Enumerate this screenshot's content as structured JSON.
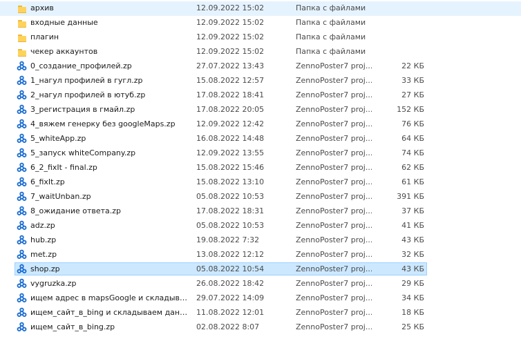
{
  "files": [
    {
      "name": "архив",
      "date": "12.09.2022 15:02",
      "type": "Папка с файлами",
      "size": "",
      "icon": "folder-icon",
      "state": "hover"
    },
    {
      "name": "входные данные",
      "date": "12.09.2022 15:02",
      "type": "Папка с файлами",
      "size": "",
      "icon": "folder-icon",
      "state": ""
    },
    {
      "name": "плагин",
      "date": "12.09.2022 15:02",
      "type": "Папка с файлами",
      "size": "",
      "icon": "folder-icon",
      "state": ""
    },
    {
      "name": "чекер аккаунтов",
      "date": "12.09.2022 15:02",
      "type": "Папка с файлами",
      "size": "",
      "icon": "folder-icon",
      "state": ""
    },
    {
      "name": "0_создание_профилей.zp",
      "date": "27.07.2022 13:43",
      "type": "ZennoPoster7 proj...",
      "size": "22 КБ",
      "icon": "zennoposter-icon",
      "state": ""
    },
    {
      "name": "1_нагул профилей в гугл.zp",
      "date": "15.08.2022 12:57",
      "type": "ZennoPoster7 proj...",
      "size": "33 КБ",
      "icon": "zennoposter-icon",
      "state": ""
    },
    {
      "name": "2_нагул профилей в ютуб.zp",
      "date": "17.08.2022 18:41",
      "type": "ZennoPoster7 proj...",
      "size": "27 КБ",
      "icon": "zennoposter-icon",
      "state": ""
    },
    {
      "name": "3_регистрация в гмайл.zp",
      "date": "17.08.2022 20:05",
      "type": "ZennoPoster7 proj...",
      "size": "152 КБ",
      "icon": "zennoposter-icon",
      "state": ""
    },
    {
      "name": "4_вяжем генерку без googleMaps.zp",
      "date": "12.09.2022 12:42",
      "type": "ZennoPoster7 proj...",
      "size": "76 КБ",
      "icon": "zennoposter-icon",
      "state": ""
    },
    {
      "name": "5_whiteApp.zp",
      "date": "16.08.2022 14:48",
      "type": "ZennoPoster7 proj...",
      "size": "64 КБ",
      "icon": "zennoposter-icon",
      "state": ""
    },
    {
      "name": "5_запуск whiteCompany.zp",
      "date": "12.09.2022 13:55",
      "type": "ZennoPoster7 proj...",
      "size": "74 КБ",
      "icon": "zennoposter-icon",
      "state": ""
    },
    {
      "name": "6_2_fixIt - final.zp",
      "date": "15.08.2022 15:46",
      "type": "ZennoPoster7 proj...",
      "size": "62 КБ",
      "icon": "zennoposter-icon",
      "state": ""
    },
    {
      "name": "6_fixIt.zp",
      "date": "15.08.2022 13:10",
      "type": "ZennoPoster7 proj...",
      "size": "61 КБ",
      "icon": "zennoposter-icon",
      "state": ""
    },
    {
      "name": "7_waitUnban.zp",
      "date": "05.08.2022 10:53",
      "type": "ZennoPoster7 proj...",
      "size": "391 КБ",
      "icon": "zennoposter-icon",
      "state": ""
    },
    {
      "name": "8_ожидание ответа.zp",
      "date": "17.08.2022 18:31",
      "type": "ZennoPoster7 proj...",
      "size": "37 КБ",
      "icon": "zennoposter-icon",
      "state": ""
    },
    {
      "name": "adz.zp",
      "date": "05.08.2022 10:53",
      "type": "ZennoPoster7 proj...",
      "size": "41 КБ",
      "icon": "zennoposter-icon",
      "state": ""
    },
    {
      "name": "hub.zp",
      "date": "19.08.2022 7:32",
      "type": "ZennoPoster7 proj...",
      "size": "43 КБ",
      "icon": "zennoposter-icon",
      "state": ""
    },
    {
      "name": "met.zp",
      "date": "13.08.2022 12:12",
      "type": "ZennoPoster7 proj...",
      "size": "32 КБ",
      "icon": "zennoposter-icon",
      "state": ""
    },
    {
      "name": "shop.zp",
      "date": "05.08.2022 10:54",
      "type": "ZennoPoster7 proj...",
      "size": "43 КБ",
      "icon": "zennoposter-icon",
      "state": "selected"
    },
    {
      "name": "vygruzka.zp",
      "date": "26.08.2022 18:42",
      "type": "ZennoPoster7 proj...",
      "size": "29 КБ",
      "icon": "zennoposter-icon",
      "state": ""
    },
    {
      "name": "ищем адрес в mapsGoogle и складываем...",
      "date": "29.07.2022 14:09",
      "type": "ZennoPoster7 proj...",
      "size": "34 КБ",
      "icon": "zennoposter-icon",
      "state": ""
    },
    {
      "name": "ищем_сайт_в_bing и складываем данн...",
      "date": "11.08.2022 12:01",
      "type": "ZennoPoster7 proj...",
      "size": "18 КБ",
      "icon": "zennoposter-icon",
      "state": ""
    },
    {
      "name": "ищем_сайт_в_bing.zp",
      "date": "02.08.2022 8:07",
      "type": "ZennoPoster7 proj...",
      "size": "25 КБ",
      "icon": "zennoposter-icon",
      "state": ""
    }
  ],
  "colors": {
    "hover_bg": "#e5f3ff",
    "selected_bg": "#cce8ff",
    "selected_border": "#99d1ff",
    "folder": "#ffd35b",
    "zennoposter": "#1f6fd1"
  }
}
